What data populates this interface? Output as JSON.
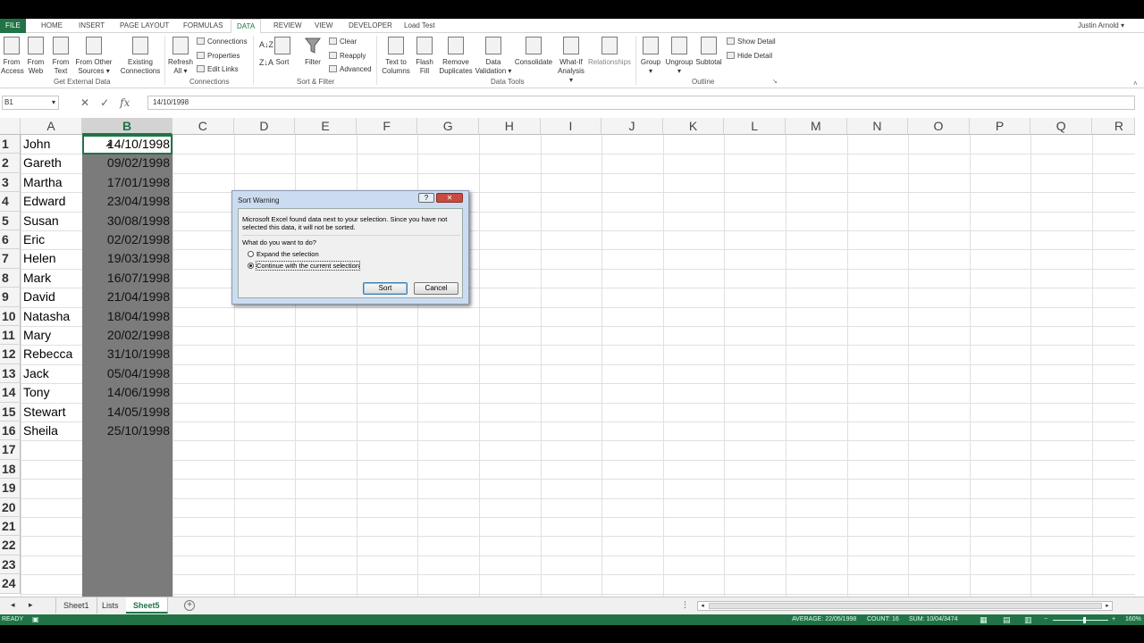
{
  "ribbon_tabs": [
    "FILE",
    "HOME",
    "INSERT",
    "PAGE LAYOUT",
    "FORMULAS",
    "DATA",
    "REVIEW",
    "VIEW",
    "DEVELOPER",
    "Load Test"
  ],
  "user_name": "Justin Arnold",
  "ribbon": {
    "get_external": {
      "from_access": [
        "From",
        "Access"
      ],
      "from_web": [
        "From",
        "Web"
      ],
      "from_text": [
        "From",
        "Text"
      ],
      "from_other": [
        "From Other",
        "Sources ▾"
      ],
      "existing": [
        "Existing",
        "Connections"
      ],
      "label": "Get External Data"
    },
    "connections": {
      "refresh": [
        "Refresh",
        "All ▾"
      ],
      "connections": "Connections",
      "properties": "Properties",
      "edit_links": "Edit Links",
      "label": "Connections"
    },
    "sort_filter": {
      "sort": "Sort",
      "filter": "Filter",
      "clear": "Clear",
      "reapply": "Reapply",
      "advanced": "Advanced",
      "label": "Sort & Filter"
    },
    "data_tools": {
      "text_to_columns": [
        "Text to",
        "Columns"
      ],
      "flash_fill": [
        "Flash",
        "Fill"
      ],
      "remove_duplicates": [
        "Remove",
        "Duplicates"
      ],
      "data_validation": [
        "Data",
        "Validation ▾"
      ],
      "consolidate": "Consolidate",
      "what_if": [
        "What-If",
        "Analysis ▾"
      ],
      "relationships": "Relationships",
      "label": "Data Tools"
    },
    "outline": {
      "group": [
        "Group",
        "▾"
      ],
      "ungroup": [
        "Ungroup",
        "▾"
      ],
      "subtotal": "Subtotal",
      "show_detail": "Show Detail",
      "hide_detail": "Hide Detail",
      "label": "Outline"
    }
  },
  "name_box": "B1",
  "formula_value": "14/10/1998",
  "columns": [
    "A",
    "B",
    "C",
    "D",
    "E",
    "F",
    "G",
    "H",
    "I",
    "J",
    "K",
    "L",
    "M",
    "N",
    "O",
    "P",
    "Q",
    "R"
  ],
  "rows": [
    "1",
    "2",
    "3",
    "4",
    "5",
    "6",
    "7",
    "8",
    "9",
    "10",
    "11",
    "12",
    "13",
    "14",
    "15",
    "16",
    "17",
    "18",
    "19",
    "20",
    "21",
    "22",
    "23",
    "24"
  ],
  "names": [
    "John",
    "Gareth",
    "Martha",
    "Edward",
    "Susan",
    "Eric",
    "Helen",
    "Mark",
    "David",
    "Natasha",
    "Mary",
    "Rebecca",
    "Jack",
    "Tony",
    "Stewart",
    "Sheila"
  ],
  "dates": [
    "14/10/1998",
    "09/02/1998",
    "17/01/1998",
    "23/04/1998",
    "30/08/1998",
    "02/02/1998",
    "19/03/1998",
    "16/07/1998",
    "21/04/1998",
    "18/04/1998",
    "20/02/1998",
    "31/10/1998",
    "05/04/1998",
    "14/06/1998",
    "14/05/1998",
    "25/10/1998"
  ],
  "dialog": {
    "title": "Sort Warning",
    "help": "?",
    "close": "✕",
    "message_line1": "Microsoft Excel found data next to your selection.  Since you have not",
    "message_line2": "selected this data, it will not be sorted.",
    "question": "What do you want to do?",
    "option_expand": "Expand the selection",
    "option_continue": "Continue with the current selection",
    "sort_button": "Sort",
    "cancel_button": "Cancel"
  },
  "sheets": [
    "Sheet1",
    "Lists",
    "Sheet5"
  ],
  "active_sheet": "Sheet5",
  "status": {
    "ready": "READY",
    "average": "AVERAGE: 22/05/1998",
    "count": "COUNT: 16",
    "sum": "SUM: 10/04/3474",
    "zoom": "160%"
  },
  "colors": {
    "accent": "#217346",
    "selection": "#7b7b7b",
    "dialog_frame": "#cbdcf0"
  }
}
